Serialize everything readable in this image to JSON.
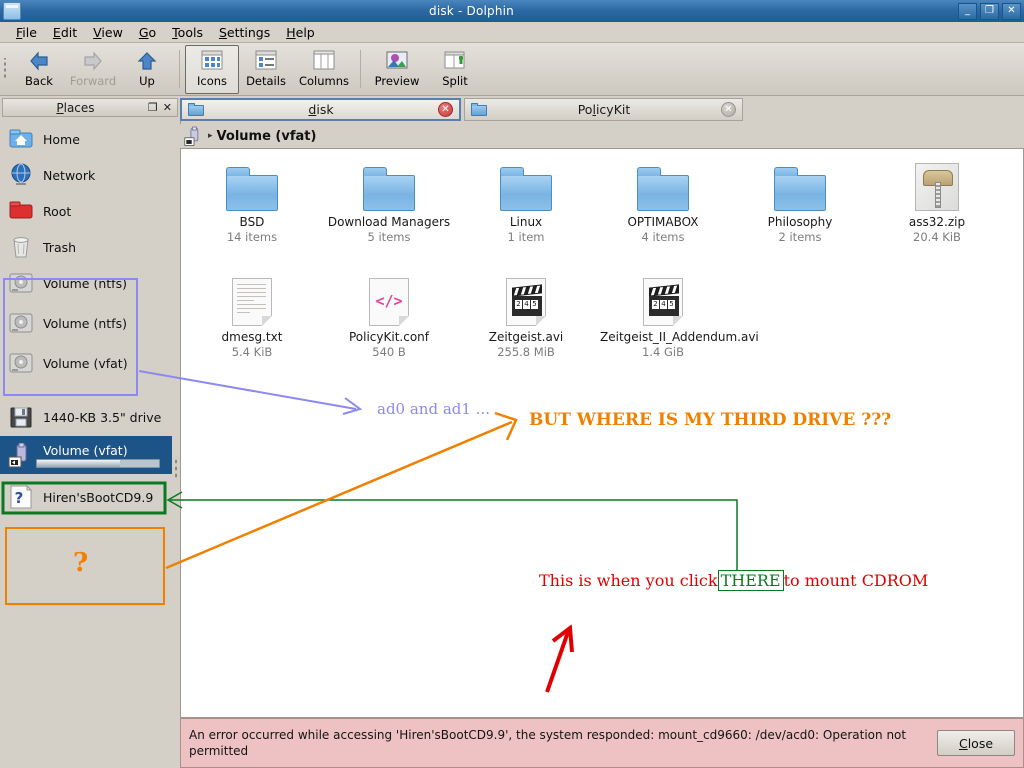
{
  "window": {
    "title": "disk - Dolphin",
    "icon": "dolphin-icon",
    "buttons": {
      "minimize": "_",
      "maximize": "❐",
      "close": "✕"
    }
  },
  "menubar": [
    {
      "label": "File",
      "accel": "F"
    },
    {
      "label": "Edit",
      "accel": "E"
    },
    {
      "label": "View",
      "accel": "V"
    },
    {
      "label": "Go",
      "accel": "G"
    },
    {
      "label": "Tools",
      "accel": "T"
    },
    {
      "label": "Settings",
      "accel": "S"
    },
    {
      "label": "Help",
      "accel": "H"
    }
  ],
  "toolbar": [
    {
      "label": "Back",
      "icon": "back-arrow-icon",
      "state": "enabled"
    },
    {
      "label": "Forward",
      "icon": "forward-arrow-icon",
      "state": "disabled"
    },
    {
      "label": "Up",
      "icon": "up-arrow-icon",
      "state": "enabled"
    },
    {
      "label": "Icons",
      "icon": "icons-view-icon",
      "state": "checked"
    },
    {
      "label": "Details",
      "icon": "details-view-icon",
      "state": "enabled"
    },
    {
      "label": "Columns",
      "icon": "columns-view-icon",
      "state": "enabled"
    },
    {
      "label": "Preview",
      "icon": "preview-icon",
      "state": "enabled"
    },
    {
      "label": "Split",
      "icon": "split-view-icon",
      "state": "enabled"
    }
  ],
  "places": {
    "header": {
      "title": "Places",
      "accel": "P",
      "float_button": "❐",
      "close_button": "✕"
    },
    "items": [
      {
        "label": "Home",
        "icon": "home-folder-icon",
        "selected": false
      },
      {
        "label": "Network",
        "icon": "network-globe-icon",
        "selected": false
      },
      {
        "label": "Root",
        "icon": "root-folder-icon",
        "selected": false
      },
      {
        "label": "Trash",
        "icon": "trash-bin-icon",
        "selected": false
      },
      {
        "label": "Volume (ntfs)",
        "icon": "hard-disk-icon",
        "selected": false
      },
      {
        "label": "Volume (ntfs)",
        "icon": "hard-disk-icon",
        "selected": false
      },
      {
        "label": "Volume (vfat)",
        "icon": "hard-disk-icon",
        "selected": false
      },
      {
        "label": "1440-KB 3.5\" drive",
        "icon": "floppy-disk-icon",
        "selected": false
      },
      {
        "label": "Volume (vfat)",
        "icon": "usb-drive-icon",
        "selected": true,
        "capacity_percent": 68
      },
      {
        "label": "Hiren'sBootCD9.9",
        "icon": "unknown-media-icon",
        "selected": false
      }
    ]
  },
  "tabs": [
    {
      "label": "disk",
      "accel": "d",
      "active": true,
      "close": "✕"
    },
    {
      "label": "PolicyKit",
      "accel": "l",
      "active": false,
      "close": "✕"
    }
  ],
  "breadcrumb": {
    "icon": "usb-drive-icon",
    "separator": "▸",
    "path": "Volume (vfat)"
  },
  "files": [
    {
      "name": "BSD",
      "detail": "14 items",
      "type": "folder"
    },
    {
      "name": "Download Managers",
      "detail": "5 items",
      "type": "folder"
    },
    {
      "name": "Linux",
      "detail": "1 item",
      "type": "folder"
    },
    {
      "name": "OPTIMABOX",
      "detail": "4 items",
      "type": "folder"
    },
    {
      "name": "Philosophy",
      "detail": "2 items",
      "type": "folder"
    },
    {
      "name": "ass32.zip",
      "detail": "20.4 KiB",
      "type": "archive"
    },
    {
      "name": "dmesg.txt",
      "detail": "5.4 KiB",
      "type": "text"
    },
    {
      "name": "PolicyKit.conf",
      "detail": "540 B",
      "type": "code"
    },
    {
      "name": "Zeitgeist.avi",
      "detail": "255.8 MiB",
      "type": "video"
    },
    {
      "name": "Zeitgeist_II_Addendum.avi",
      "detail": "1.4 GiB",
      "type": "video"
    }
  ],
  "error_bar": {
    "message": "An error occurred while accessing 'Hiren'sBootCD9.9', the system responded: mount_cd9660: /dev/acd0: Operation not permitted",
    "close_label": "Close",
    "close_accel": "C"
  },
  "annotations": {
    "blue_note": "ad0 and ad1 ...",
    "orange_note": "BUT WHERE IS MY THIRD DRIVE ???",
    "red_note_prefix": "This is when you click ",
    "green_highlight": "THERE",
    "red_note_suffix": " to mount CDROM",
    "orange_question_mark": "?"
  },
  "colors": {
    "titlebar": "#2d6aa5",
    "selection": "#1c5488",
    "chrome": "#d4d0c8",
    "error_bg": "#eec2c2",
    "anno_blue": "#8a8af0",
    "anno_orange": "#f08000",
    "anno_red": "#e00000",
    "anno_green": "#0a7a22"
  }
}
